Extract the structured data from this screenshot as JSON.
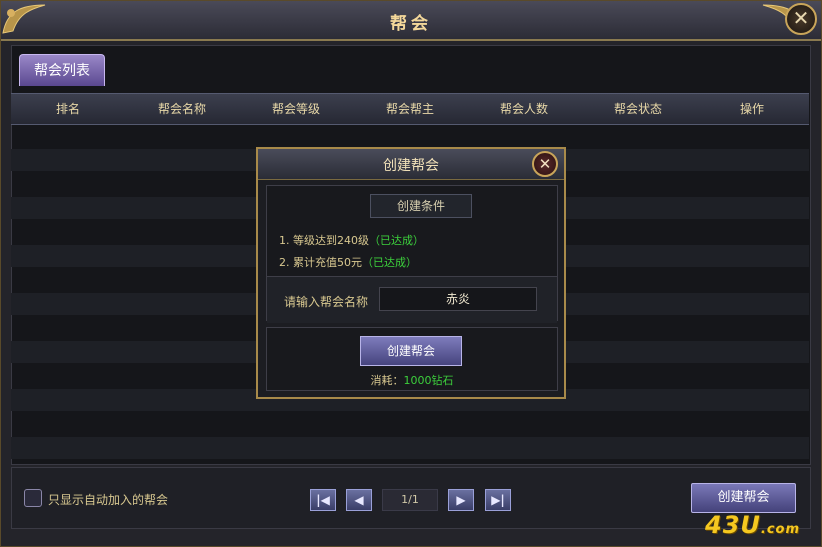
{
  "window": {
    "title": "帮会"
  },
  "tabs": [
    {
      "label": "帮会列表",
      "active": true
    }
  ],
  "table": {
    "columns": [
      "排名",
      "帮会名称",
      "帮会等级",
      "帮会帮主",
      "帮会人数",
      "帮会状态",
      "操作"
    ],
    "rows": []
  },
  "bottom": {
    "auto_join_label": "只显示自动加入的帮会",
    "auto_join_checked": false,
    "page_info": "1/1",
    "create_button": "创建帮会"
  },
  "dialog": {
    "title": "创建帮会",
    "conditions_title": "创建条件",
    "conditions": [
      {
        "text": "1. 等级达到240级",
        "status": "（已达成）"
      },
      {
        "text": "2. 累计充值50元",
        "status": "（已达成）"
      }
    ],
    "name_label": "请输入帮会名称",
    "name_value": "赤炎",
    "create_button": "创建帮会",
    "cost_label": "消耗：",
    "cost_value": "1000钻石"
  },
  "watermark": {
    "text": "43U",
    "suffix": ".com"
  },
  "colors": {
    "accent_gold": "#f4d89a",
    "achieved_green": "#3ccf3c",
    "button_purple": "#5a4890"
  }
}
